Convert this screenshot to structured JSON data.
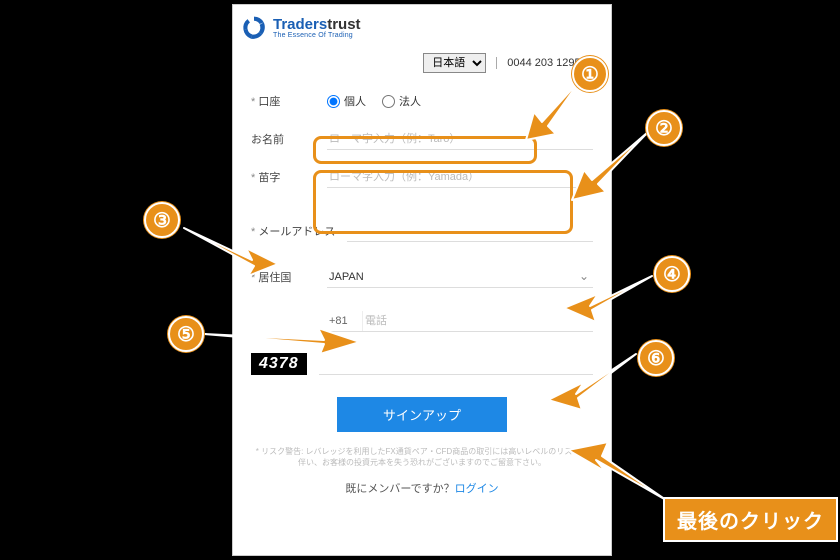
{
  "logo": {
    "brand_blue": "Traders",
    "brand_black": "trust",
    "tag": "The Essence Of Trading"
  },
  "topbar": {
    "lang": "日本語",
    "phone": "0044 203 1295899"
  },
  "form": {
    "account": {
      "label": "口座",
      "opt_personal": "個人",
      "opt_corporate": "法人"
    },
    "name": {
      "label": "お名前",
      "ph": "ローマ字入力（例：Taro）"
    },
    "surname": {
      "label": "苗字",
      "ph": "ローマ字入力（例：Yamada）"
    },
    "email": {
      "label": "メールアドレス"
    },
    "country": {
      "label": "居住国",
      "value": "JAPAN"
    },
    "phone": {
      "cc": "+81",
      "ph": "電話"
    },
    "captcha": {
      "img": "4378"
    }
  },
  "button": {
    "signup": "サインアップ"
  },
  "disclaimer": "* リスク警告: レバレッジを利用したFX通貨ペア・CFD商品の取引には高いレベルのリスクが伴い、お客様の投資元本を失う恐れがございますのでご留意下さい。",
  "already": {
    "q": "既にメンバーですか？",
    "link": "ログイン"
  },
  "annot": {
    "b1": "①",
    "b2": "②",
    "b3": "③",
    "b4": "④",
    "b5": "⑤",
    "b6": "⑥",
    "last": "最後のクリック"
  }
}
